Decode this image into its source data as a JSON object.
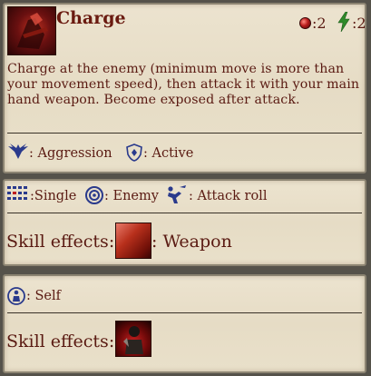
{
  "skill": {
    "title": "Charge",
    "cost_health": ":2",
    "cost_stamina": ":2",
    "description": "Charge at the enemy (minimum move is more than your movement speed), then attack it with your main hand weapon. Become exposed after attack.",
    "aggression_label": ": Aggression",
    "active_label": ": Active"
  },
  "targeting": {
    "area_label": ":Single",
    "target_label": ": Enemy",
    "roll_label": ": Attack roll",
    "effects_label": "Skill effects:",
    "effect_type": ": Weapon"
  },
  "self_section": {
    "target_label": ": Self",
    "effects_label": "Skill effects:"
  },
  "colors": {
    "panel_bg": "#e9e0ca",
    "text": "#5a1a12",
    "icon_blue": "#2a3a8c",
    "stamina_green": "#2f8a2a"
  }
}
